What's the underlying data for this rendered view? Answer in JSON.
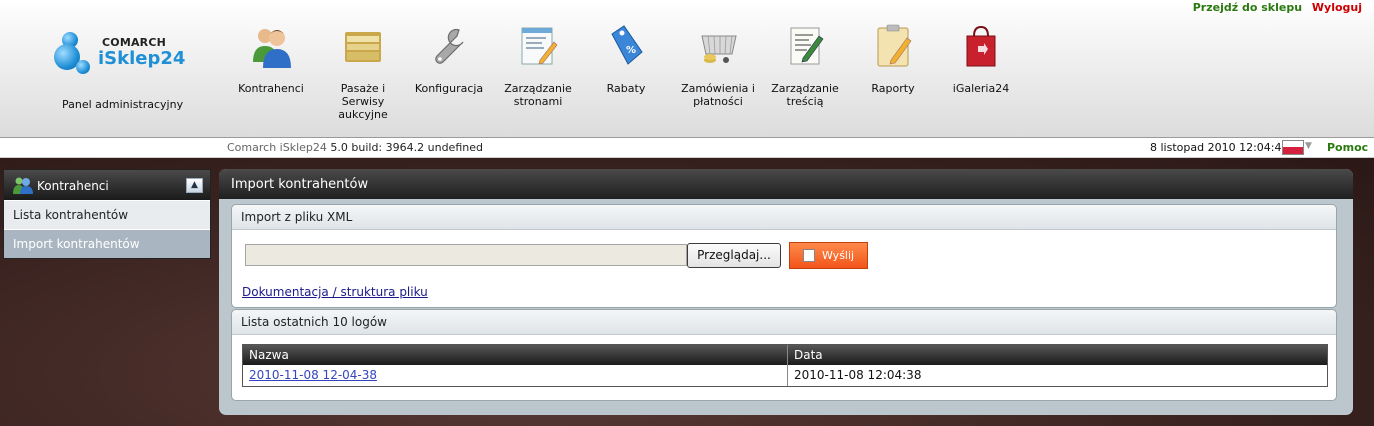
{
  "top_links": {
    "shop": "Przejdź do sklepu",
    "logout": "Wyloguj"
  },
  "logo": {
    "company": "COMARCH",
    "product": "iSklep24",
    "caption": "Panel administracyjny"
  },
  "nav": [
    {
      "label": "Kontrahenci",
      "icon": "users-icon"
    },
    {
      "label": "Pasaże i Serwisy aukcyjne",
      "icon": "folder-icon"
    },
    {
      "label": "Konfiguracja",
      "icon": "wrench-icon"
    },
    {
      "label": "Zarządzanie stronami",
      "icon": "page-edit-icon"
    },
    {
      "label": "Rabaty",
      "icon": "discount-tag-icon"
    },
    {
      "label": "Zamówienia i płatności",
      "icon": "cart-icon"
    },
    {
      "label": "Zarządzanie treścią",
      "icon": "content-edit-icon"
    },
    {
      "label": "Raporty",
      "icon": "clipboard-icon"
    },
    {
      "label": "iGaleria24",
      "icon": "shopping-bag-icon"
    }
  ],
  "status": {
    "build_prefix": "Comarch iSklep24",
    "build_version": "5.0 build: 3964.2",
    "build_suffix": "undefined",
    "datetime": "8 listopad 2010 12:04:48",
    "help": "Pomoc"
  },
  "sidebar": {
    "title": "Kontrahenci",
    "items": [
      {
        "label": "Lista kontrahentów",
        "active": false
      },
      {
        "label": "Import kontrahentów",
        "active": true
      }
    ]
  },
  "main": {
    "title": "Import kontrahentów",
    "import_panel": {
      "title": "Import z pliku XML",
      "file_value": "",
      "browse_label": "Przeglądaj...",
      "send_label": "Wyślij",
      "doc_link": "Dokumentacja / struktura pliku"
    },
    "logs_panel": {
      "title": "Lista ostatnich 10 logów",
      "columns": [
        "Nazwa",
        "Data"
      ],
      "rows": [
        {
          "name": "2010-11-08 12-04-38",
          "date": "2010-11-08 12:04:38"
        }
      ]
    }
  },
  "colors": {
    "accent_green": "#2a7a10",
    "logout_red": "#cc0000",
    "send_orange": "#f2541a",
    "header_dark": "#1f1f1f"
  }
}
